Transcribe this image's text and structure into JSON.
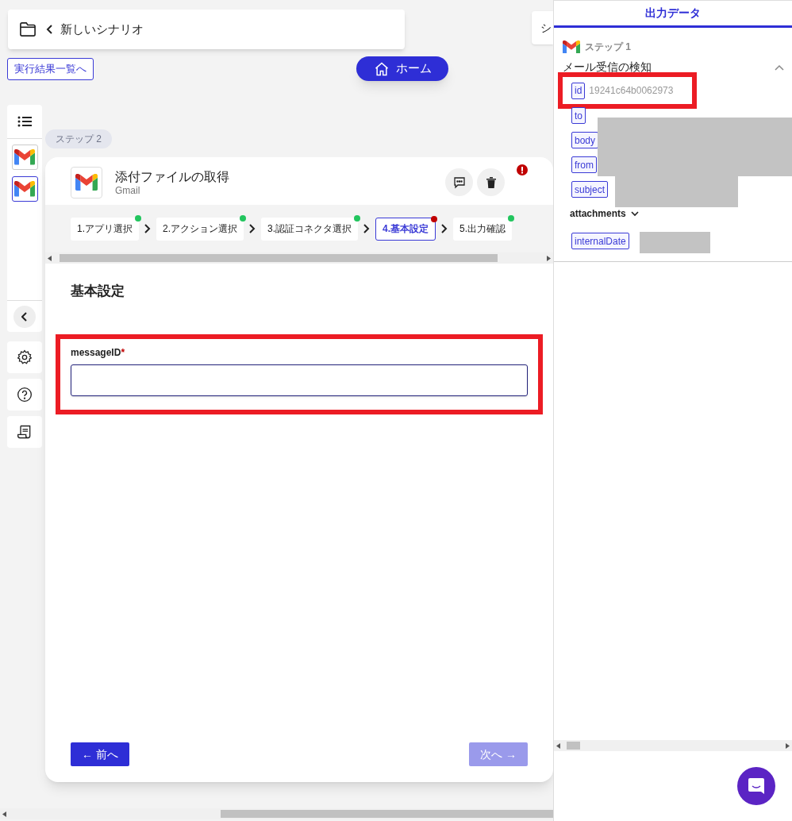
{
  "header": {
    "title": "新しいシナリオ",
    "side_button": "シ"
  },
  "results_link": "実行結果一覧へ",
  "home_button": "ホーム",
  "sidebar": {
    "steps": [
      {
        "selected": false
      },
      {
        "selected": true
      }
    ]
  },
  "step_badge": "ステップ 2",
  "step_card": {
    "title": "添付ファイルの取得",
    "app": "Gmail",
    "has_error": true,
    "wizard": [
      {
        "label": "1.アプリ選択",
        "has_error": false,
        "selected": false
      },
      {
        "label": "2.アクション選択",
        "has_error": false,
        "selected": false
      },
      {
        "label": "3.認証コネクタ選択",
        "has_error": false,
        "selected": false
      },
      {
        "label": "4.基本設定",
        "has_error": true,
        "selected": true
      },
      {
        "label": "5.出力確認",
        "has_error": false,
        "selected": false
      }
    ],
    "section_title": "基本設定",
    "fields": [
      {
        "label": "messageID",
        "required_mark": "*",
        "highlighted": true
      }
    ],
    "prev_button": "← 前へ",
    "next_button": {
      "label": "次へ →",
      "disabled": true
    }
  },
  "output_panel": {
    "tab": "出力データ",
    "step": "ステップ 1",
    "trigger": "メール受信の検知",
    "expanded": true,
    "items": [
      {
        "kind": "field",
        "key": "id",
        "value": "19241c64b0062973",
        "highlighted": true
      },
      {
        "kind": "field",
        "key": "to",
        "highlighted": false
      },
      {
        "kind": "field",
        "key": "body",
        "highlighted": false
      },
      {
        "kind": "field",
        "key": "from",
        "highlighted": false
      },
      {
        "kind": "field",
        "key": "subject",
        "highlighted": false
      },
      {
        "kind": "group",
        "key": "attachments",
        "expanded": false
      },
      {
        "kind": "field",
        "key": "internalDate",
        "highlighted": false
      }
    ]
  }
}
